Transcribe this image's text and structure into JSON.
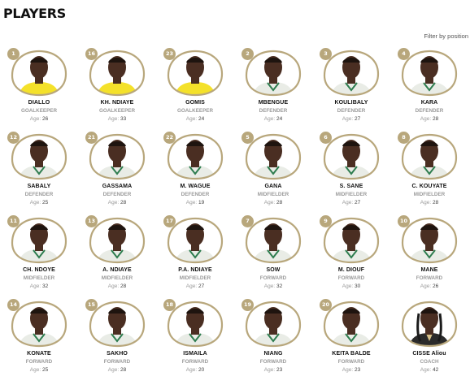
{
  "page": {
    "title": "PLAYERS",
    "filter_label": "Filter by position"
  },
  "colors": {
    "gold": "#b8a77c",
    "skin": "#4a2e22",
    "jersey_white": "#e9ece6",
    "gk_yellow": "#f4e12a"
  },
  "age_label": "Age:",
  "players": [
    {
      "num": "1",
      "name": "DIALLO",
      "position": "GOALKEEPER",
      "age": "26",
      "kit": "yellow"
    },
    {
      "num": "16",
      "name": "KH. NDIAYE",
      "position": "GOALKEEPER",
      "age": "33",
      "kit": "yellow"
    },
    {
      "num": "23",
      "name": "GOMIS",
      "position": "GOALKEEPER",
      "age": "24",
      "kit": "yellow"
    },
    {
      "num": "2",
      "name": "MBENGUE",
      "position": "DEFENDER",
      "age": "24",
      "kit": "white"
    },
    {
      "num": "3",
      "name": "KOULIBALY",
      "position": "DEFENDER",
      "age": "27",
      "kit": "white"
    },
    {
      "num": "4",
      "name": "KARA",
      "position": "DEFENDER",
      "age": "28",
      "kit": "white"
    },
    {
      "num": "12",
      "name": "SABALY",
      "position": "DEFENDER",
      "age": "25",
      "kit": "white"
    },
    {
      "num": "21",
      "name": "GASSAMA",
      "position": "DEFENDER",
      "age": "28",
      "kit": "white"
    },
    {
      "num": "22",
      "name": "M. WAGUE",
      "position": "DEFENDER",
      "age": "19",
      "kit": "white"
    },
    {
      "num": "5",
      "name": "GANA",
      "position": "MIDFIELDER",
      "age": "28",
      "kit": "white"
    },
    {
      "num": "6",
      "name": "S. SANE",
      "position": "MIDFIELDER",
      "age": "27",
      "kit": "white"
    },
    {
      "num": "8",
      "name": "C. KOUYATE",
      "position": "MIDFIELDER",
      "age": "28",
      "kit": "white"
    },
    {
      "num": "11",
      "name": "CH. NDOYE",
      "position": "MIDFIELDER",
      "age": "32",
      "kit": "white"
    },
    {
      "num": "13",
      "name": "A. NDIAYE",
      "position": "MIDFIELDER",
      "age": "28",
      "kit": "white"
    },
    {
      "num": "17",
      "name": "P.A. NDIAYE",
      "position": "MIDFIELDER",
      "age": "27",
      "kit": "white"
    },
    {
      "num": "7",
      "name": "SOW",
      "position": "FORWARD",
      "age": "32",
      "kit": "white"
    },
    {
      "num": "9",
      "name": "M. DIOUF",
      "position": "FORWARD",
      "age": "30",
      "kit": "white"
    },
    {
      "num": "10",
      "name": "MANE",
      "position": "FORWARD",
      "age": "26",
      "kit": "white"
    },
    {
      "num": "14",
      "name": "KONATE",
      "position": "FORWARD",
      "age": "25",
      "kit": "white"
    },
    {
      "num": "15",
      "name": "SAKHO",
      "position": "FORWARD",
      "age": "28",
      "kit": "white"
    },
    {
      "num": "18",
      "name": "ISMAILA",
      "position": "FORWARD",
      "age": "20",
      "kit": "white"
    },
    {
      "num": "19",
      "name": "NIANG",
      "position": "FORWARD",
      "age": "23",
      "kit": "white"
    },
    {
      "num": "20",
      "name": "KEITA BALDE",
      "position": "FORWARD",
      "age": "23",
      "kit": "white"
    },
    {
      "num": "",
      "name": "CISSE Aliou",
      "position": "COACH",
      "age": "42",
      "kit": "coach"
    }
  ]
}
